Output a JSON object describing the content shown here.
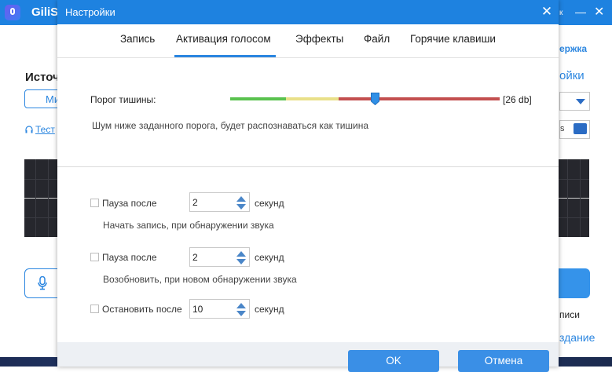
{
  "background_app": {
    "title": "GiliS",
    "top_right_text": "к",
    "minimize_glyph": "—",
    "close_glyph": "✕",
    "left_title": "Источ",
    "left_button": "Ми",
    "test_link": "Тест",
    "right_support": "ержка",
    "right_settings": "ойки",
    "right_path": "s",
    "right_bottom_text": "писи",
    "right_bottom_link": "здание"
  },
  "dialog": {
    "title": "Настройки",
    "close_glyph": "✕"
  },
  "tabs": [
    {
      "label": "Запись"
    },
    {
      "label": "Активация голосом",
      "active": true
    },
    {
      "label": "Эффекты"
    },
    {
      "label": "Файл"
    },
    {
      "label": "Горячие клавиши"
    }
  ],
  "threshold": {
    "label": "Порог тишины:",
    "value_text": "[26 db]",
    "level_fraction": 0.54,
    "hint": "Шум ниже заданного порога, будет распознаваться как тишина",
    "colors": {
      "low": "#59c24e",
      "mid": "#e9e089",
      "high": "#c34f4f",
      "thumb": "#2f8fe6"
    }
  },
  "options": [
    {
      "checked": false,
      "label": "Пауза после",
      "value": "2",
      "unit": "секунд",
      "description": "Начать запись, при обнаружении звука"
    },
    {
      "checked": false,
      "label": "Пауза после",
      "value": "2",
      "unit": "секунд",
      "description": "Возобновить, при новом обнаружении звука"
    },
    {
      "checked": false,
      "label": "Остановить после",
      "value": "10",
      "unit": "секунд"
    }
  ],
  "buttons": {
    "ok": "OK",
    "cancel": "Отмена"
  },
  "colors": {
    "accent": "#1e82e0",
    "button": "#3a8fe6"
  }
}
